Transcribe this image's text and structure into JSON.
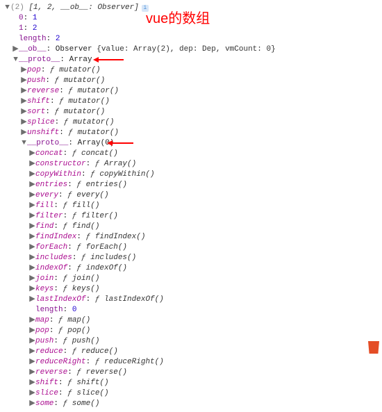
{
  "title": "vue的数组",
  "root": {
    "count": "(2)",
    "summary": "[1, 2, __ob__: Observer]",
    "idx0": {
      "key": "0",
      "val": "1"
    },
    "idx1": {
      "key": "1",
      "val": "2"
    },
    "length": {
      "key": "length",
      "val": "2"
    },
    "ob": {
      "key": "__ob__",
      "type": "Observer",
      "summary": "{value: Array(2), dep: Dep, vmCount: 0}"
    }
  },
  "proto1": {
    "key": "__proto__",
    "type": "Array",
    "methods": [
      {
        "k": "pop",
        "v": "mutator()"
      },
      {
        "k": "push",
        "v": "mutator()"
      },
      {
        "k": "reverse",
        "v": "mutator()"
      },
      {
        "k": "shift",
        "v": "mutator()"
      },
      {
        "k": "sort",
        "v": "mutator()"
      },
      {
        "k": "splice",
        "v": "mutator()"
      },
      {
        "k": "unshift",
        "v": "mutator()"
      }
    ]
  },
  "proto2": {
    "key": "__proto__",
    "type": "Array(0)",
    "methods": [
      {
        "k": "concat",
        "v": "concat()"
      },
      {
        "k": "constructor",
        "v": "Array()"
      },
      {
        "k": "copyWithin",
        "v": "copyWithin()"
      },
      {
        "k": "entries",
        "v": "entries()"
      },
      {
        "k": "every",
        "v": "every()"
      },
      {
        "k": "fill",
        "v": "fill()"
      },
      {
        "k": "filter",
        "v": "filter()"
      },
      {
        "k": "find",
        "v": "find()"
      },
      {
        "k": "findIndex",
        "v": "findIndex()"
      },
      {
        "k": "forEach",
        "v": "forEach()"
      },
      {
        "k": "includes",
        "v": "includes()"
      },
      {
        "k": "indexOf",
        "v": "indexOf()"
      },
      {
        "k": "join",
        "v": "join()"
      },
      {
        "k": "keys",
        "v": "keys()"
      },
      {
        "k": "lastIndexOf",
        "v": "lastIndexOf()"
      }
    ],
    "length": {
      "key": "length",
      "val": "0"
    },
    "methods2": [
      {
        "k": "map",
        "v": "map()"
      },
      {
        "k": "pop",
        "v": "pop()"
      },
      {
        "k": "push",
        "v": "push()"
      },
      {
        "k": "reduce",
        "v": "reduce()"
      },
      {
        "k": "reduceRight",
        "v": "reduceRight()"
      },
      {
        "k": "reverse",
        "v": "reverse()"
      },
      {
        "k": "shift",
        "v": "shift()"
      },
      {
        "k": "slice",
        "v": "slice()"
      },
      {
        "k": "some",
        "v": "some()"
      }
    ]
  },
  "glyphs": {
    "down": "▼",
    "right": "▶",
    "f": "ƒ",
    "info": "i"
  }
}
